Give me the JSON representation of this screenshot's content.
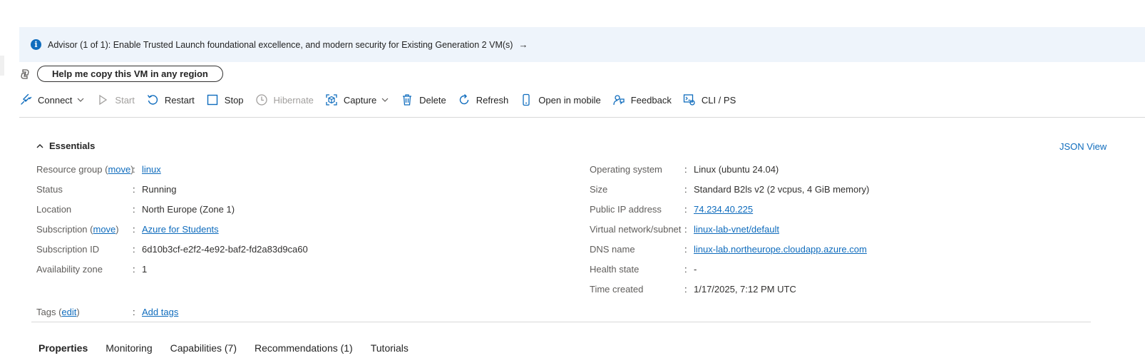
{
  "advisor": {
    "text": "Advisor (1 of 1): Enable Trusted Launch foundational excellence, and modern security for Existing Generation 2 VM(s)",
    "arrow": "→"
  },
  "copilot": {
    "button_label": "Help me copy this VM in any region"
  },
  "toolbar": [
    {
      "label": "Connect",
      "icon": "plug-icon",
      "disabled": false,
      "dropdown": true
    },
    {
      "label": "Start",
      "icon": "play-icon",
      "disabled": true,
      "dropdown": false
    },
    {
      "label": "Restart",
      "icon": "restart-icon",
      "disabled": false,
      "dropdown": false
    },
    {
      "label": "Stop",
      "icon": "stop-icon",
      "disabled": false,
      "dropdown": false
    },
    {
      "label": "Hibernate",
      "icon": "hibernate-icon",
      "disabled": true,
      "dropdown": false
    },
    {
      "label": "Capture",
      "icon": "capture-icon",
      "disabled": false,
      "dropdown": true
    },
    {
      "label": "Delete",
      "icon": "trash-icon",
      "disabled": false,
      "dropdown": false
    },
    {
      "label": "Refresh",
      "icon": "refresh-icon",
      "disabled": false,
      "dropdown": false
    },
    {
      "label": "Open in mobile",
      "icon": "mobile-icon",
      "disabled": false,
      "dropdown": false
    },
    {
      "label": "Feedback",
      "icon": "feedback-icon",
      "disabled": false,
      "dropdown": false
    },
    {
      "label": "CLI / PS",
      "icon": "cli-icon",
      "disabled": false,
      "dropdown": false
    }
  ],
  "essentials": {
    "title": "Essentials",
    "json_view": "JSON View",
    "left": {
      "resource_group": {
        "label": "Resource group",
        "move": "move",
        "value": "linux"
      },
      "status": {
        "label": "Status",
        "value": "Running"
      },
      "location": {
        "label": "Location",
        "value": "North Europe (Zone 1)"
      },
      "subscription": {
        "label": "Subscription",
        "move": "move",
        "value": "Azure for Students"
      },
      "subscription_id": {
        "label": "Subscription ID",
        "value": "6d10b3cf-e2f2-4e92-baf2-fd2a83d9ca60"
      },
      "availability_zone": {
        "label": "Availability zone",
        "value": "1"
      }
    },
    "right": {
      "os": {
        "label": "Operating system",
        "value": "Linux (ubuntu 24.04)"
      },
      "size": {
        "label": "Size",
        "value": "Standard B2ls v2 (2 vcpus, 4 GiB memory)"
      },
      "public_ip": {
        "label": "Public IP address",
        "value": "74.234.40.225"
      },
      "vnet": {
        "label": "Virtual network/subnet",
        "value": "linux-lab-vnet/default"
      },
      "dns": {
        "label": "DNS name",
        "value": "linux-lab.northeurope.cloudapp.azure.com"
      },
      "health": {
        "label": "Health state",
        "value": "-"
      },
      "time_created": {
        "label": "Time created",
        "value": "1/17/2025, 7:12 PM UTC"
      }
    },
    "tags": {
      "label": "Tags",
      "edit": "edit",
      "value": "Add tags"
    }
  },
  "tabs": [
    {
      "label": "Properties",
      "active": true
    },
    {
      "label": "Monitoring",
      "active": false
    },
    {
      "label": "Capabilities (7)",
      "active": false
    },
    {
      "label": "Recommendations (1)",
      "active": false
    },
    {
      "label": "Tutorials",
      "active": false
    }
  ],
  "colors": {
    "accent": "#0f6cbd",
    "banner": "#eef4fb",
    "disabled": "#a19f9d"
  }
}
